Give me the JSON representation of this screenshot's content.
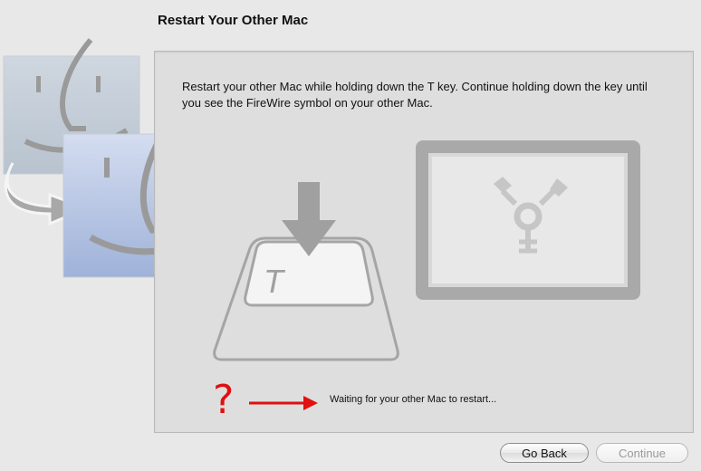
{
  "window": {
    "title": "Restart Your Other Mac"
  },
  "panel": {
    "instructions": "Restart your other Mac while holding down the T key. Continue holding down the key until you see the FireWire symbol on your other Mac.",
    "key_label": "T",
    "status_question": "?",
    "status_text": "Waiting for your other Mac to restart..."
  },
  "buttons": {
    "back_label": "Go Back",
    "continue_label": "Continue"
  },
  "colors": {
    "status_red": "#e01010"
  },
  "icons": [
    "finder-icon",
    "curved-arrow-icon",
    "t-key-icon",
    "down-arrow-icon",
    "firewire-icon",
    "red-arrow-icon"
  ]
}
